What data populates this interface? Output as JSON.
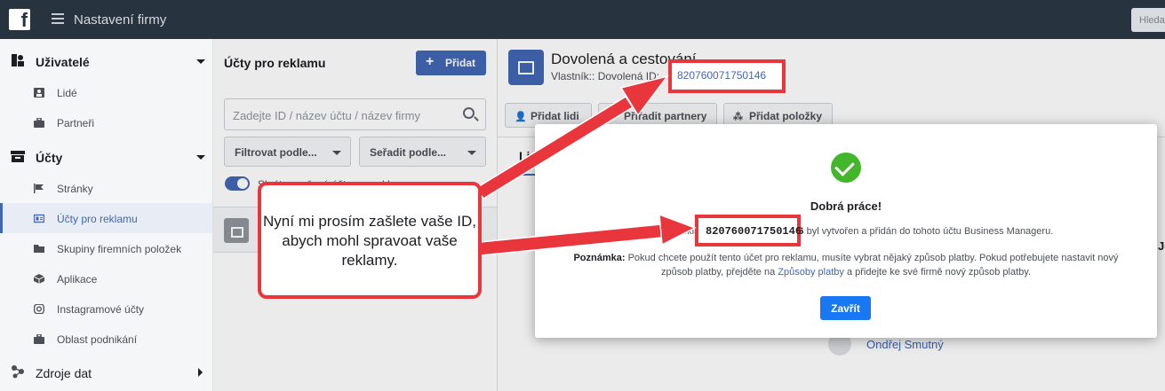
{
  "topbar": {
    "title": "Nastavení firmy",
    "search_label": "Hledat",
    "logo_letter": "f"
  },
  "sidebar": {
    "users_section": "Uživatelé",
    "people": "Lidé",
    "partners": "Partneři",
    "accounts_section": "Účty",
    "pages": "Stránky",
    "ad_accounts": "Účty pro reklamu",
    "catalogs": "Skupiny firemních položek",
    "apps": "Aplikace",
    "instagram": "Instagramové účty",
    "business_area": "Oblast podnikání",
    "data_sources": "Zdroje dat"
  },
  "middle": {
    "title": "Účty pro reklamu",
    "add_button": "Přidat",
    "search_placeholder": "Zadejte ID / název účtu / název firmy",
    "filter_label": "Filtrovat podle...",
    "sort_label": "Seřadit podle...",
    "toggle_label": "Skrýt uzavřené účty pro reklamu"
  },
  "detail": {
    "title": "Dovolená a cestování",
    "owner_text": "Vlastník:: Dovolená  ID:",
    "account_id": "820760071750146",
    "btn_add_people": "Přidat lidi",
    "btn_assign_partners": "Přiřadit partnery",
    "btn_add_items": "Přidat položky",
    "tab_people": "Lidé",
    "person_name": "Ondřej Smutný",
    "right_clip": "Je"
  },
  "modal": {
    "title": "Dobrá práce!",
    "line_prefix": "Účet pro reklamu",
    "account_id": "820760071750146",
    "line_suffix": "byl vytvořen a přidán do tohoto účtu Business Manageru.",
    "note_label": "Poznámka:",
    "note_text": "Pokud chcete použít tento účet pro reklamu, musíte vybrat nějaký způsob platby. Pokud potřebujete nastavit nový způsob platby, přejděte na",
    "note_link": "Způsoby platby",
    "note_end": "a přidejte ke své firmě nový způsob platby.",
    "close_button": "Zavřít"
  },
  "annotation": {
    "callout_text": "Nyní mi prosím zašlete vaše ID, abych mohl spravoat vaše reklamy.",
    "highlight_id_top": "820760071750146",
    "highlight_id_modal": "820760071750146",
    "color": "#e8363c"
  },
  "colors": {
    "accent": "#4267b2",
    "topbar": "#283340",
    "success": "#42b72a",
    "primary_button": "#1877f2"
  }
}
